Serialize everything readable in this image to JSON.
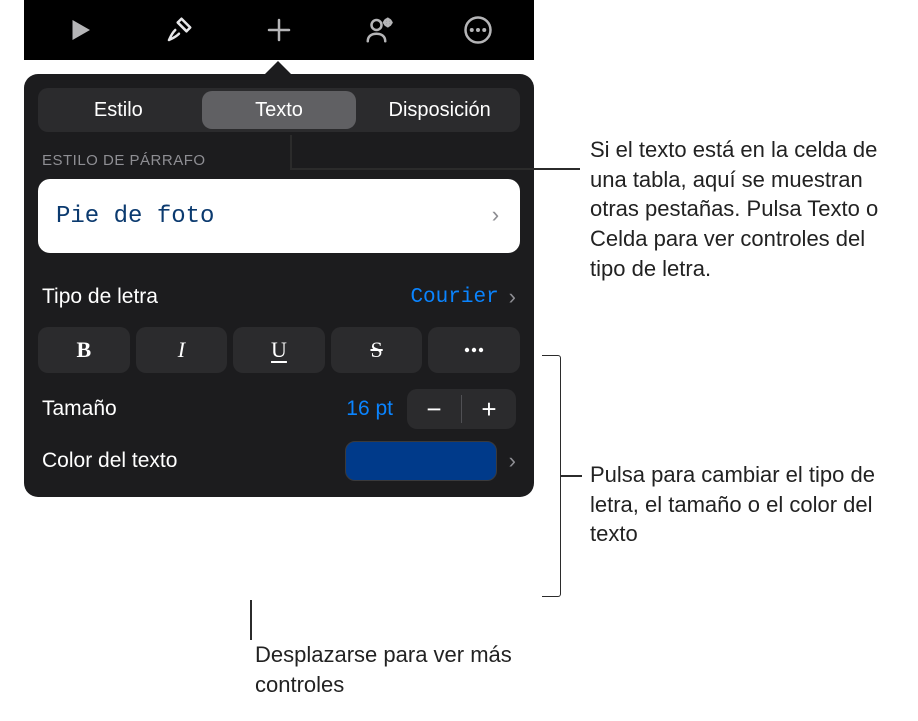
{
  "toolbar": {
    "play_icon": "play-icon",
    "format_icon": "format-brush-icon",
    "add_icon": "plus-icon",
    "collaborate_icon": "collaborate-icon",
    "more_icon": "ellipsis-icon"
  },
  "tabs": {
    "style": "Estilo",
    "text": "Texto",
    "layout": "Disposición"
  },
  "paragraph_style": {
    "header": "ESTILO DE PÁRRAFO",
    "value": "Pie de foto"
  },
  "font": {
    "label": "Tipo de letra",
    "value": "Courier"
  },
  "format_buttons": {
    "bold": "B",
    "italic": "I",
    "underline": "U",
    "strike": "S"
  },
  "size": {
    "label": "Tamaño",
    "value": "16 pt",
    "minus": "−",
    "plus": "+"
  },
  "text_color": {
    "label": "Color del texto",
    "value": "#003a8a"
  },
  "chevron": "›",
  "callouts": {
    "tabs_note": "Si el texto está en la celda de una tabla, aquí se muestran otras pestañas. Pulsa Texto o Celda para ver controles del tipo de letra.",
    "font_note": "Pulsa para cambiar el tipo de letra, el tamaño o el color del texto",
    "scroll_note": "Desplazarse para ver más controles"
  }
}
